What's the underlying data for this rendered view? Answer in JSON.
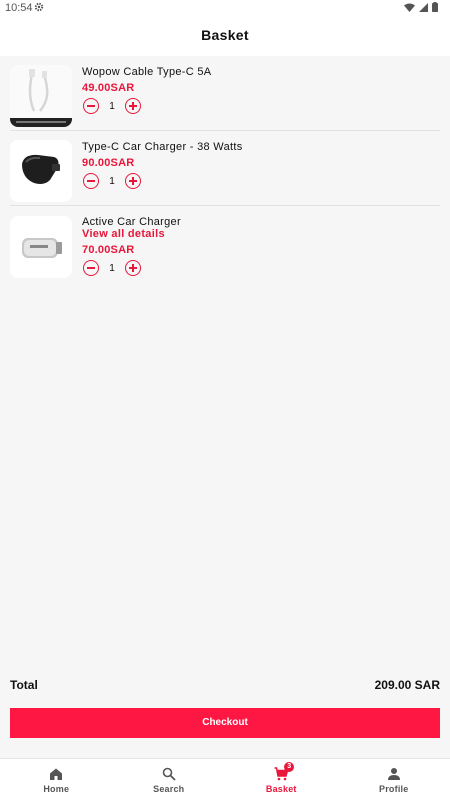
{
  "status_bar": {
    "time": "10:54"
  },
  "header": {
    "title": "Basket"
  },
  "basket": {
    "items": [
      {
        "name": "Wopow Cable Type-C 5A",
        "price": "49.00SAR",
        "quantity": "1",
        "link": ""
      },
      {
        "name": "Type-C Car Charger - 38 Watts",
        "price": "90.00SAR",
        "quantity": "1",
        "link": ""
      },
      {
        "name": "Active Car Charger",
        "price": "70.00SAR",
        "quantity": "1",
        "link": "View all details"
      }
    ]
  },
  "summary": {
    "total_label": "Total",
    "total_value": "209.00 SAR"
  },
  "checkout": {
    "label": "Checkout"
  },
  "nav": {
    "items": [
      {
        "label": "Home",
        "icon": "home-icon"
      },
      {
        "label": "Search",
        "icon": "search-icon"
      },
      {
        "label": "Basket",
        "icon": "cart-icon",
        "badge": "3"
      },
      {
        "label": "Profile",
        "icon": "person-icon"
      }
    ]
  },
  "colors": {
    "accent": "#e8173b",
    "button": "#ff1744"
  }
}
